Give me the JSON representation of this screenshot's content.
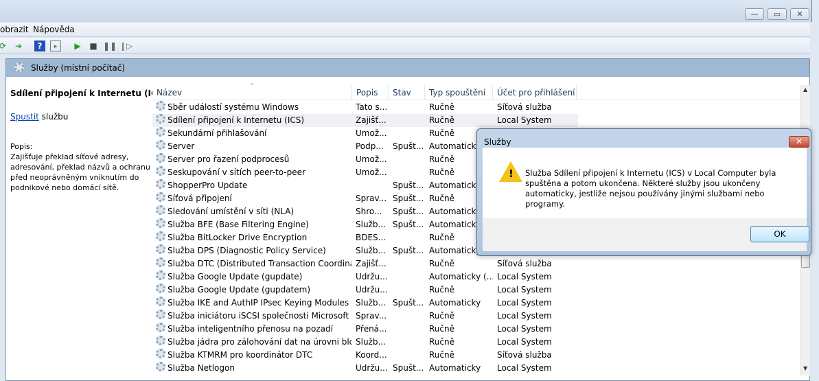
{
  "menu": {
    "items": [
      "obrazit",
      "Nápověda"
    ]
  },
  "window_controls": {
    "minimize": "—",
    "maximize": "▭",
    "close": "✕"
  },
  "banner": {
    "title": "Služby (místní počítač)"
  },
  "left_pane": {
    "service_name": "Sdílení připojení k Internetu (ICS)",
    "start_link": "Spustit",
    "start_suffix": " službu",
    "desc_label": "Popis:",
    "description": "Zajišťuje překlad síťové adresy, adresování, překlad názvů a ochranu před neoprávněným vniknutím do podnikové nebo domácí sítě."
  },
  "table": {
    "columns": [
      "Název",
      "Popis",
      "Stav",
      "Typ spouštění",
      "Účet pro přihlášení"
    ],
    "rows": [
      {
        "name": "Sběr událostí systému Windows",
        "desc": "Tato s...",
        "status": "",
        "startup": "Ručně",
        "account": "Síťová služba"
      },
      {
        "name": "Sdílení připojení k Internetu (ICS)",
        "desc": "Zajišť...",
        "status": "",
        "startup": "Ručně",
        "account": "Local System"
      },
      {
        "name": "Sekundární přihlašování",
        "desc": "Umož...",
        "status": "",
        "startup": "Ručně",
        "account": ""
      },
      {
        "name": "Server",
        "desc": "Podp...",
        "status": "Spušt...",
        "startup": "Automaticky",
        "account": ""
      },
      {
        "name": "Server pro řazení podprocesů",
        "desc": "Umož...",
        "status": "",
        "startup": "Ručně",
        "account": ""
      },
      {
        "name": "Seskupování v sítích peer-to-peer",
        "desc": "Umož...",
        "status": "",
        "startup": "Ručně",
        "account": ""
      },
      {
        "name": "ShopperPro Update",
        "desc": "",
        "status": "Spušt...",
        "startup": "Automaticky",
        "account": ""
      },
      {
        "name": "Síťová připojení",
        "desc": "Sprav...",
        "status": "Spušt...",
        "startup": "Ručně",
        "account": ""
      },
      {
        "name": "Sledování umístění v síti (NLA)",
        "desc": "Shro...",
        "status": "Spušt...",
        "startup": "Automaticky",
        "account": ""
      },
      {
        "name": "Služba BFE (Base Filtering Engine)",
        "desc": "Služb...",
        "status": "Spušt...",
        "startup": "Automaticky",
        "account": ""
      },
      {
        "name": "Služba BitLocker Drive Encryption",
        "desc": "BDES...",
        "status": "",
        "startup": "Ručně",
        "account": ""
      },
      {
        "name": "Služba DPS (Diagnostic Policy Service)",
        "desc": "Služb...",
        "status": "Spušt...",
        "startup": "Automaticky",
        "account": ""
      },
      {
        "name": "Služba DTC (Distributed Transaction Coordinator)",
        "desc": "Zajišť...",
        "status": "",
        "startup": "Ručně",
        "account": "Síťová služba"
      },
      {
        "name": "Služba Google Update (gupdate)",
        "desc": "Udržu...",
        "status": "",
        "startup": "Automaticky (...",
        "account": "Local System"
      },
      {
        "name": "Služba Google Update (gupdatem)",
        "desc": "Udržu...",
        "status": "",
        "startup": "Ručně",
        "account": "Local System"
      },
      {
        "name": "Služba IKE and AuthIP IPsec Keying Modules",
        "desc": "Služb...",
        "status": "Spušt...",
        "startup": "Automaticky",
        "account": "Local System"
      },
      {
        "name": "Služba iniciátoru iSCSI společnosti Microsoft",
        "desc": "Sprav...",
        "status": "",
        "startup": "Ručně",
        "account": "Local System"
      },
      {
        "name": "Služba inteligentního přenosu na pozadí",
        "desc": "Přená...",
        "status": "",
        "startup": "Ručně",
        "account": "Local System"
      },
      {
        "name": "Služba jádra pro zálohování dat na úrovni bloků",
        "desc": "Služb...",
        "status": "",
        "startup": "Ručně",
        "account": "Local System"
      },
      {
        "name": "Služba KTMRM pro koordinátor DTC",
        "desc": "Koord...",
        "status": "",
        "startup": "Ručně",
        "account": "Síťová služba"
      },
      {
        "name": "Služba Netlogon",
        "desc": "Udržu...",
        "status": "Spušt...",
        "startup": "Automaticky",
        "account": "Local System"
      }
    ]
  },
  "dialog": {
    "title": "Služby",
    "close": "✕",
    "message": "Služba Sdílení připojení k Internetu (ICS) v Local Computer byla spuštěna a potom ukončena. Některé služby jsou ukončeny automaticky, jestliže nejsou používány jinými službami nebo programy.",
    "ok": "OK"
  }
}
